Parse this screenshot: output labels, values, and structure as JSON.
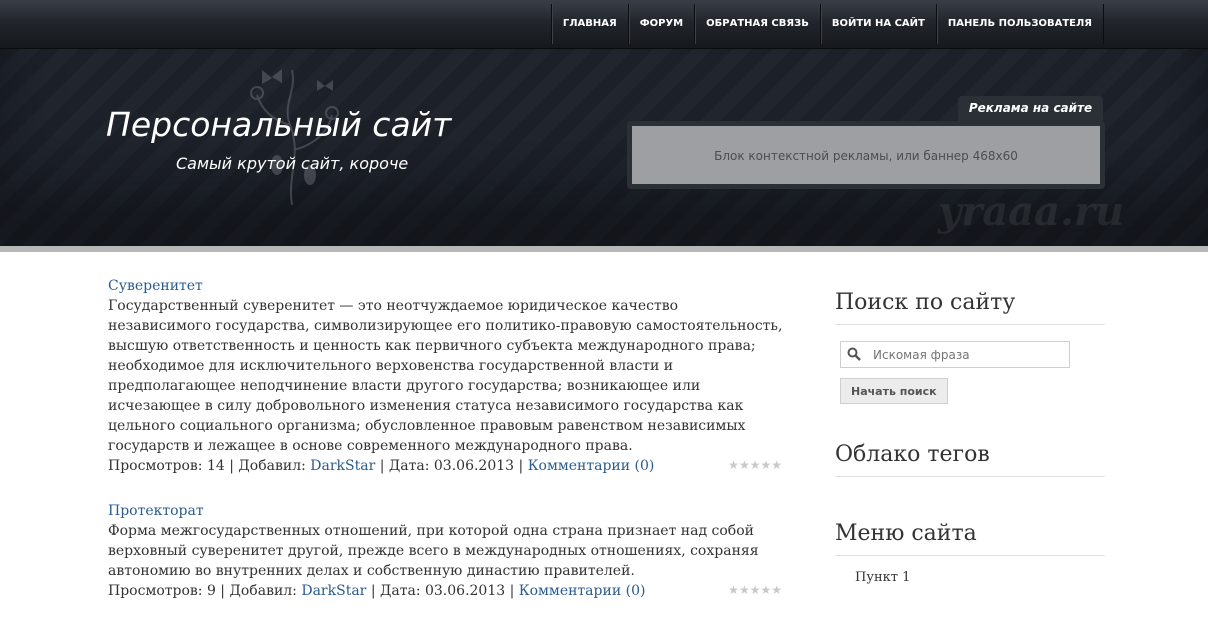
{
  "nav": {
    "items": [
      {
        "label": "ГЛАВНАЯ"
      },
      {
        "label": "ФОРУМ"
      },
      {
        "label": "ОБРАТНАЯ СВЯЗЬ"
      },
      {
        "label": "ВОЙТИ НА САЙТ"
      },
      {
        "label": "ПАНЕЛЬ ПОЛЬЗОВАТЕЛЯ"
      }
    ]
  },
  "header": {
    "title": "Персональный сайт",
    "subtitle": "Самый крутой сайт, короче",
    "ad_tab": "Реклама на сайте",
    "ad_text": "Блок контекстной рекламы, или баннер 468x60",
    "watermark": "yraaa.ru"
  },
  "posts": [
    {
      "title": "Суверенитет",
      "text": "Государственный суверенитет — это неотчуждаемое юридическое качество независимого государства, символизирующее его политико-правовую самостоятельность, высшую ответственность и ценность как первичного субъекта международного права; необходимое для исключительного верховенства государственной власти и предполагающее неподчинение власти другого государства; возникающее или исчезающее в силу добровольного изменения статуса независимого государства как цельного социального организма; обусловленное правовым равенством независимых государств и лежащее в основе современного международного права.",
      "views_label": "Просмотров: 14",
      "added_label": "Добавил:",
      "author": "DarkStar",
      "date_label": "Дата: 03.06.2013",
      "comments": "Комментарии (0)"
    },
    {
      "title": "Протекторат",
      "text": "Форма межгосударственных отношений, при которой одна страна признает над собой верховный суверенитет другой, прежде всего в международных отношениях, сохраняя автономию во внутренних делах и собственную династию правителей.",
      "views_label": "Просмотров: 9",
      "added_label": "Добавил:",
      "author": "DarkStar",
      "date_label": "Дата: 03.06.2013",
      "comments": "Комментарии (0)"
    }
  ],
  "sidebar": {
    "search_title": "Поиск по сайту",
    "search_placeholder": "Искомая фраза",
    "search_button": "Начать поиск",
    "tags_title": "Облако тегов",
    "menu_title": "Меню сайта",
    "menu_first_item": "Пункт 1"
  },
  "icons": {
    "search": "search-icon",
    "star": "star-icon"
  },
  "colors": {
    "link": "#2a5b8f",
    "header_bg": "#1c2028"
  }
}
